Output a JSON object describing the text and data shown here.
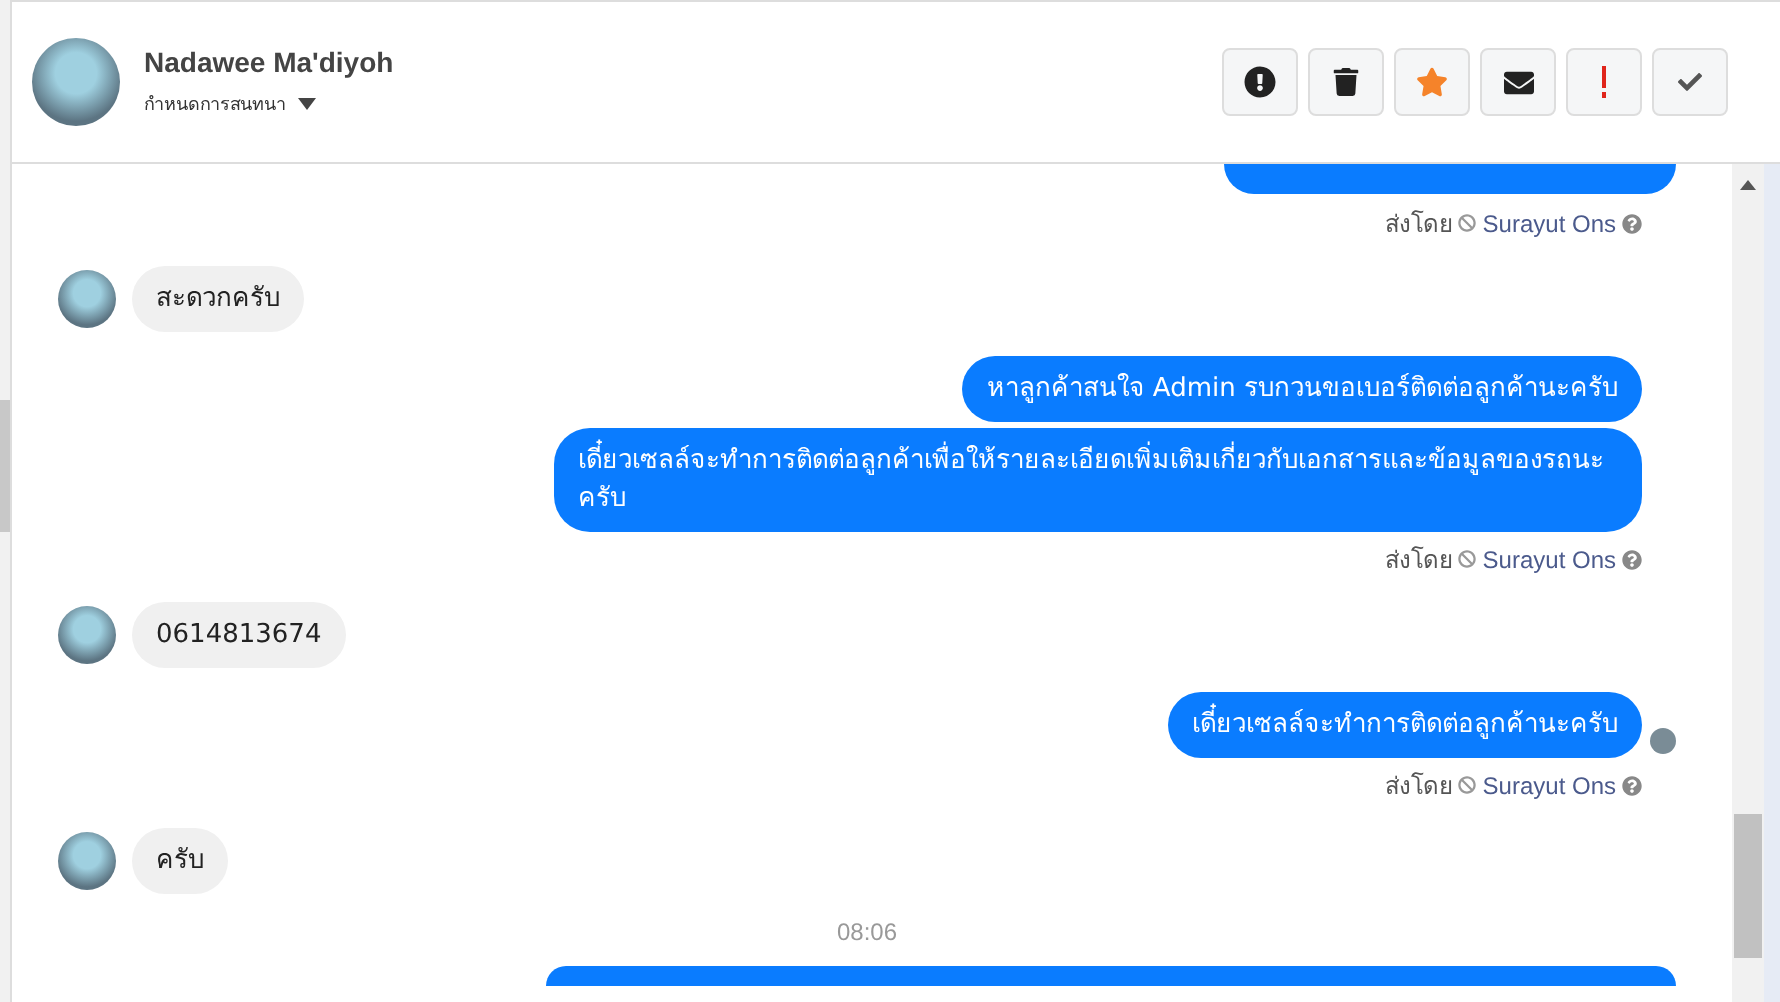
{
  "header": {
    "name": "Nadawee Ma'diyoh",
    "subtitle": "กำหนดการสนทนา",
    "actions": [
      {
        "kind": "alert"
      },
      {
        "kind": "trash"
      },
      {
        "kind": "star"
      },
      {
        "kind": "mail"
      },
      {
        "kind": "important"
      },
      {
        "kind": "done"
      }
    ]
  },
  "messages": [
    {
      "kind": "outgoing_cut"
    },
    {
      "kind": "sent_by",
      "label": "ส่งโดย",
      "agent": "Surayut Ons"
    },
    {
      "kind": "incoming",
      "text": "สะดวกครับ"
    },
    {
      "kind": "outgoing",
      "text": "หาลูกค้าสนใจ Admin รบกวนขอเบอร์ติดต่อลูกค้านะครับ",
      "seen": false
    },
    {
      "kind": "outgoing",
      "text": "เดี๋ยวเซลล์จะทำการติดต่อลูกค้าเพื่อให้รายละเอียดเพิ่มเติมเกี่ยวกับเอกสารและข้อมูลของรถนะครับ",
      "seen": false
    },
    {
      "kind": "sent_by",
      "label": "ส่งโดย",
      "agent": "Surayut Ons"
    },
    {
      "kind": "incoming",
      "text": "0614813674"
    },
    {
      "kind": "outgoing",
      "text": "เดี๋ยวเซลล์จะทำการติดต่อลูกค้านะครับ",
      "seen": true
    },
    {
      "kind": "sent_by",
      "label": "ส่งโดย",
      "agent": "Surayut Ons"
    },
    {
      "kind": "incoming",
      "text": "ครับ"
    },
    {
      "kind": "time",
      "text": "08:06"
    },
    {
      "kind": "outgoing_cut_bottom"
    }
  ]
}
